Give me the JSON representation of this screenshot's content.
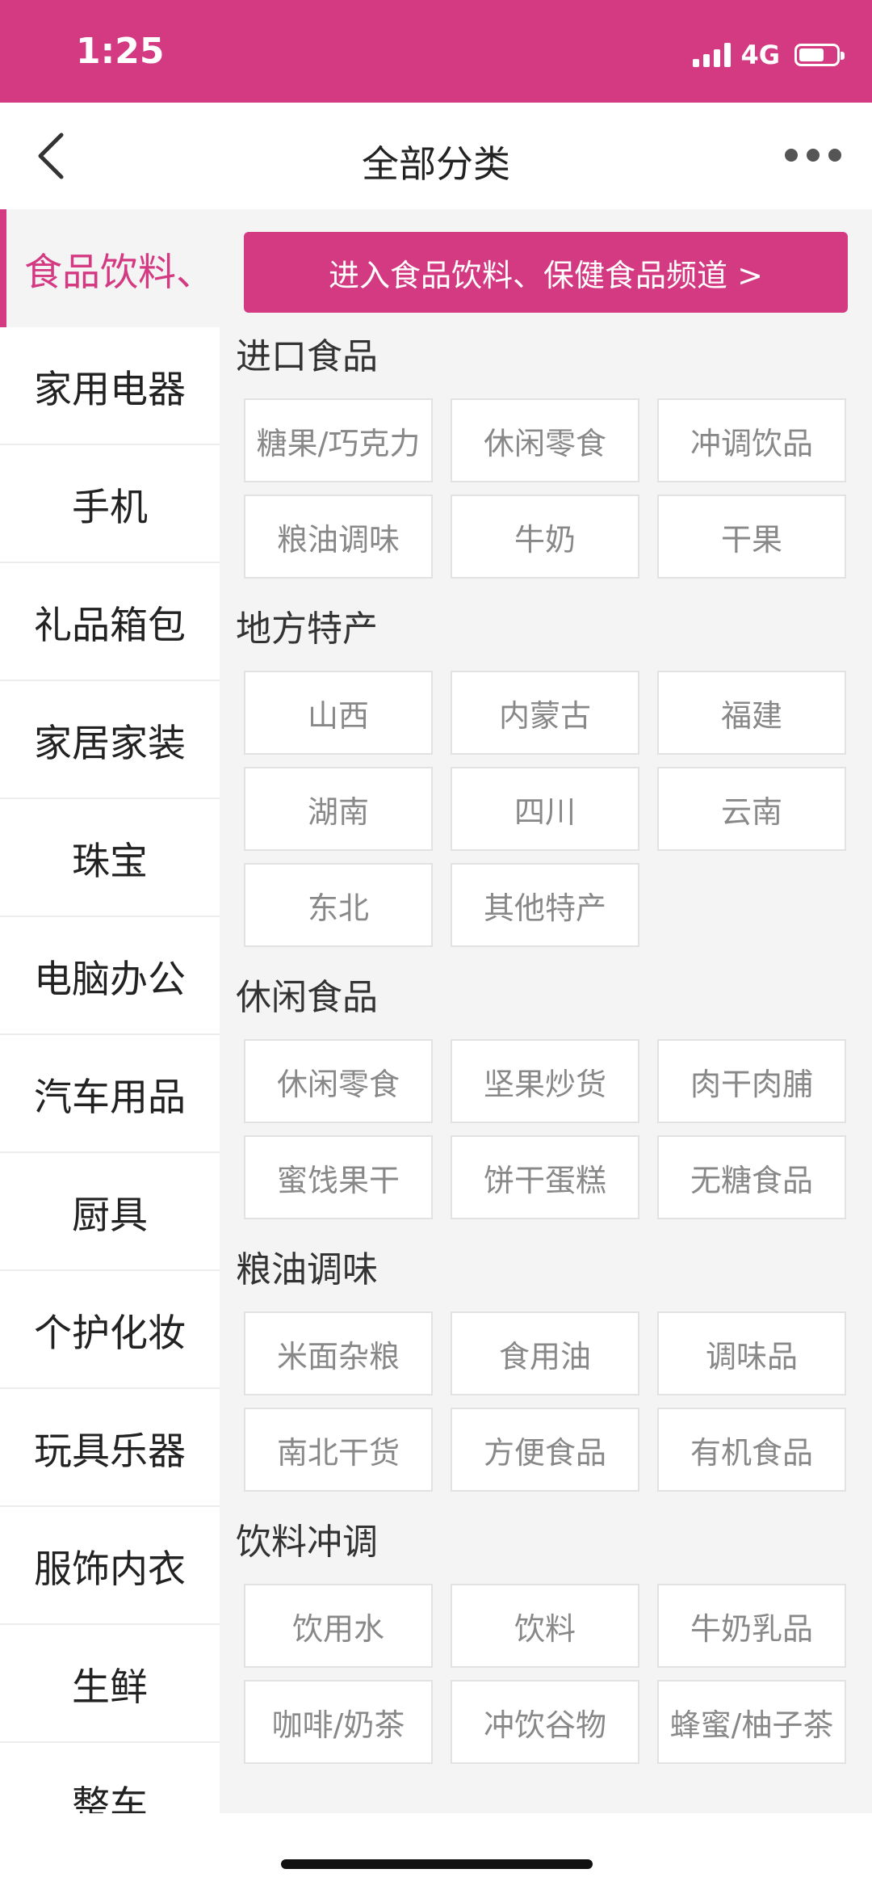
{
  "status_bar": {
    "time": "1:25",
    "network": "4G"
  },
  "header": {
    "title": "全部分类"
  },
  "sidebar": {
    "items": [
      "食品饮料、",
      "家用电器",
      "手机",
      "礼品箱包",
      "家居家装",
      "珠宝",
      "电脑办公",
      "汽车用品",
      "厨具",
      "个护化妆",
      "玩具乐器",
      "服饰内衣",
      "生鲜",
      "整车"
    ]
  },
  "banner": {
    "label": "进入食品饮料、保健食品频道 >"
  },
  "sections": [
    {
      "title": "进口食品",
      "items": [
        "糖果/巧克力",
        "休闲零食",
        "冲调饮品",
        "粮油调味",
        "牛奶",
        "干果"
      ]
    },
    {
      "title": "地方特产",
      "items": [
        "山西",
        "内蒙古",
        "福建",
        "湖南",
        "四川",
        "云南",
        "东北",
        "其他特产"
      ]
    },
    {
      "title": "休闲食品",
      "items": [
        "休闲零食",
        "坚果炒货",
        "肉干肉脯",
        "蜜饯果干",
        "饼干蛋糕",
        "无糖食品"
      ]
    },
    {
      "title": "粮油调味",
      "items": [
        "米面杂粮",
        "食用油",
        "调味品",
        "南北干货",
        "方便食品",
        "有机食品"
      ]
    },
    {
      "title": "饮料冲调",
      "items": [
        "饮用水",
        "饮料",
        "牛奶乳品",
        "咖啡/奶茶",
        "冲饮谷物",
        "蜂蜜/柚子茶"
      ]
    }
  ],
  "colors": {
    "accent": "#d33a82",
    "background": "#f4f4f4"
  }
}
